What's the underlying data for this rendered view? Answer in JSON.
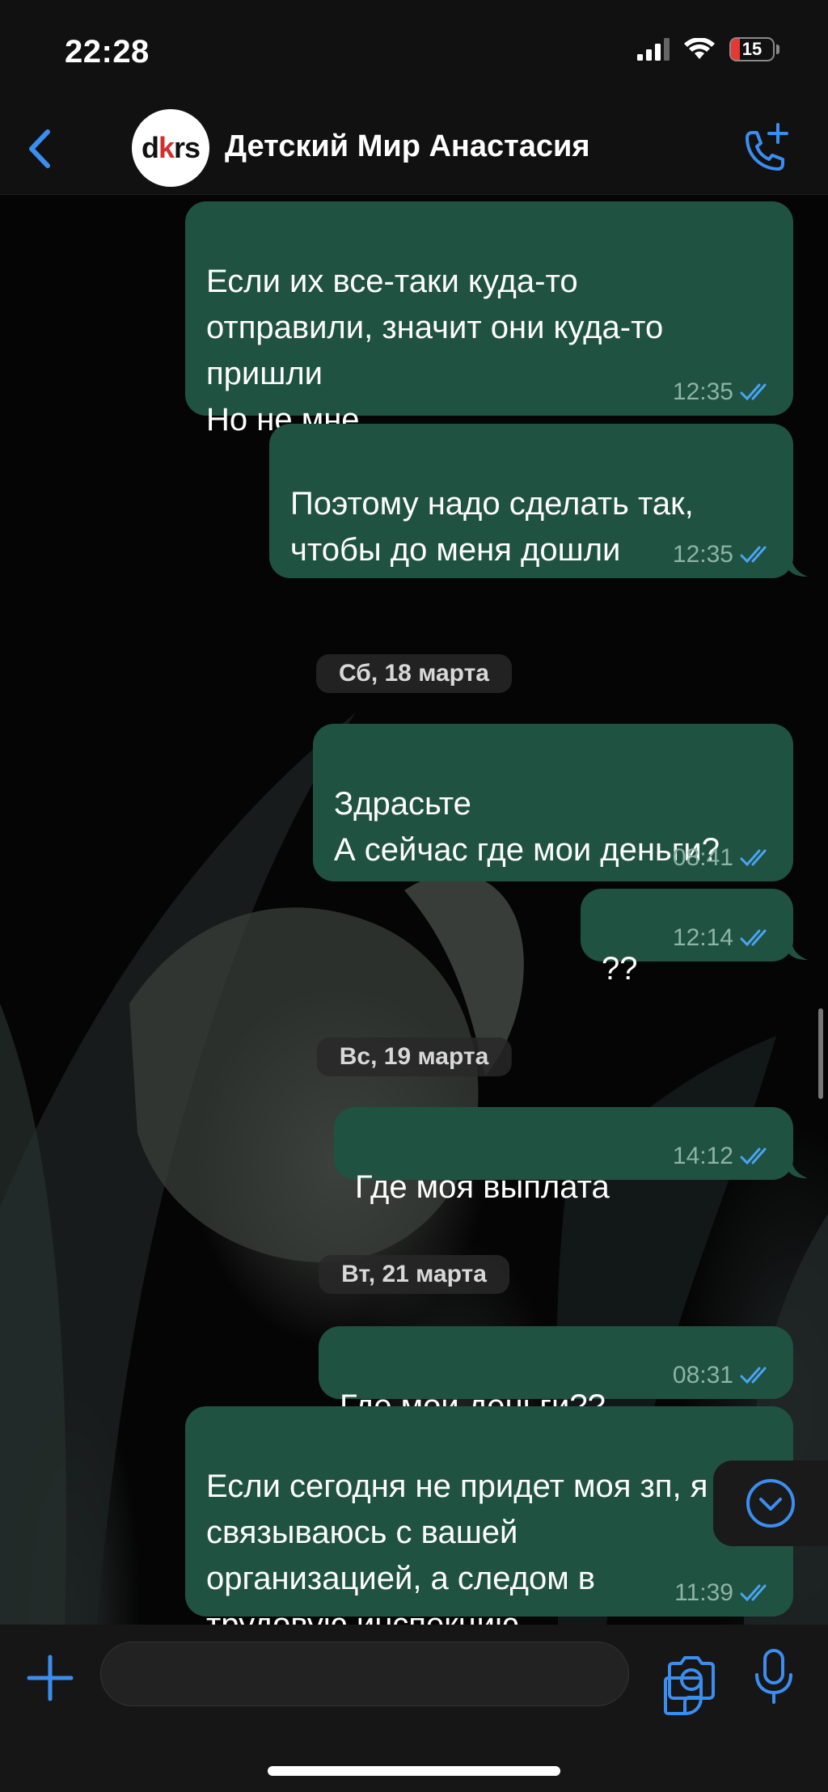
{
  "status_bar": {
    "time": "22:28",
    "battery": "15",
    "battery_color": "#e53935"
  },
  "header": {
    "contact_name": "Детский Мир Анастасия",
    "avatar_logo": "dkrs",
    "accent_color": "#3b8ef0"
  },
  "messages": [
    {
      "text": "Если их все-таки куда-то\nотправили, значит они куда-то\nпришли\nНо не мне",
      "time": "12:35"
    },
    {
      "text": "Поэтому надо сделать так,\nчтобы до меня дошли",
      "time": "12:35"
    },
    {
      "text": "Здрасьте\nА сейчас где мои деньги?",
      "time": "08:41"
    },
    {
      "text": "??",
      "time": "12:14"
    },
    {
      "text": "Где моя выплата",
      "time": "14:12"
    },
    {
      "text": "Где мои деньги??",
      "time": "08:31"
    },
    {
      "text": "Если сегодня не придет моя зп, я\nсвязываюсь с вашей\nорганизацией, а следом в\nтрудовую инспекцию",
      "time": "11:39"
    }
  ],
  "date_separators": [
    "Сб, 18 марта",
    "Вс, 19 марта",
    "Вт, 21 марта"
  ],
  "colors": {
    "outgoing_bubble": "#1f5241",
    "read_ticks": "#4aa3f5",
    "chat_background": "#050505"
  },
  "icons": [
    "back-chevron-icon",
    "add-call-icon",
    "plus-icon",
    "sticker-icon",
    "camera-icon",
    "microphone-icon",
    "scroll-down-icon",
    "double-check-icon"
  ]
}
